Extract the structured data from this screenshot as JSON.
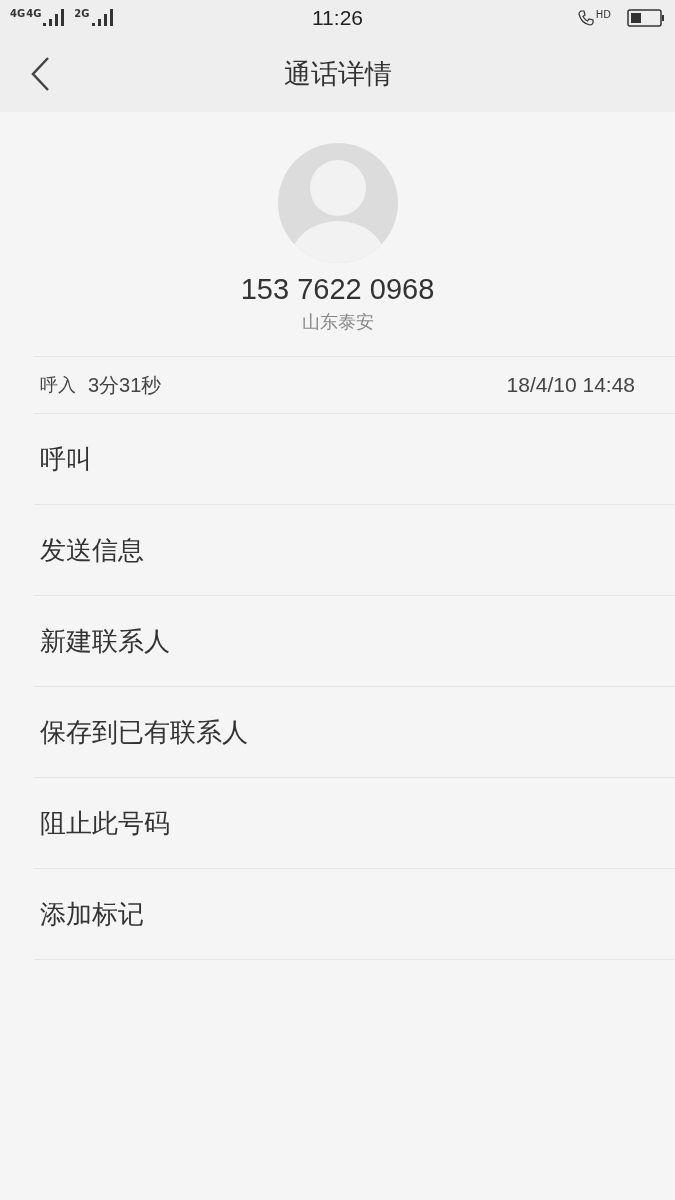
{
  "status_bar": {
    "network_1": "4G",
    "network_2": "4G",
    "network_3": "2G",
    "time": "11:26",
    "call_badge": "HD"
  },
  "header": {
    "title": "通话详情"
  },
  "contact": {
    "number": "153 7622 0968",
    "location": "山东泰安"
  },
  "call_record": {
    "direction": "呼入",
    "duration": "3分31秒",
    "datetime": "18/4/10 14:48"
  },
  "actions": [
    {
      "label": "呼叫"
    },
    {
      "label": "发送信息"
    },
    {
      "label": "新建联系人"
    },
    {
      "label": "保存到已有联系人"
    },
    {
      "label": "阻止此号码"
    },
    {
      "label": "添加标记"
    }
  ]
}
